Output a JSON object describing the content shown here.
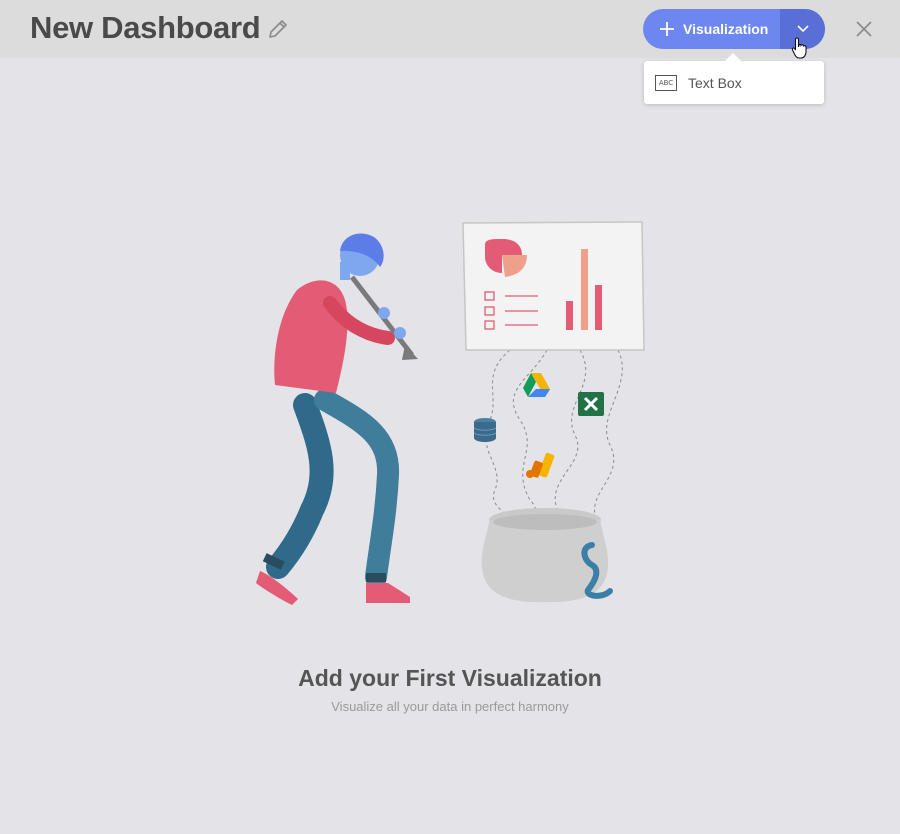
{
  "header": {
    "title": "New Dashboard",
    "edit_icon": "pencil-icon",
    "close_icon": "close-icon"
  },
  "toolbar": {
    "visualization_label": "Visualization",
    "plus_icon": "plus-icon",
    "dropdown_icon": "chevron-down-icon",
    "accent_color": "#6e87f0",
    "split_color": "#5a6ed8"
  },
  "dropdown_menu": {
    "items": [
      {
        "label": "Text Box",
        "icon_text": "ABC",
        "icon": "text-box-icon"
      }
    ]
  },
  "empty_state": {
    "title": "Add your First Visualization",
    "subtitle": "Visualize all your data in perfect harmony",
    "illustration": "flute-player-illustration"
  },
  "colors": {
    "background": "#e3e3e8",
    "topbar": "#dcdcdc",
    "title_text": "#4a4a4a"
  }
}
